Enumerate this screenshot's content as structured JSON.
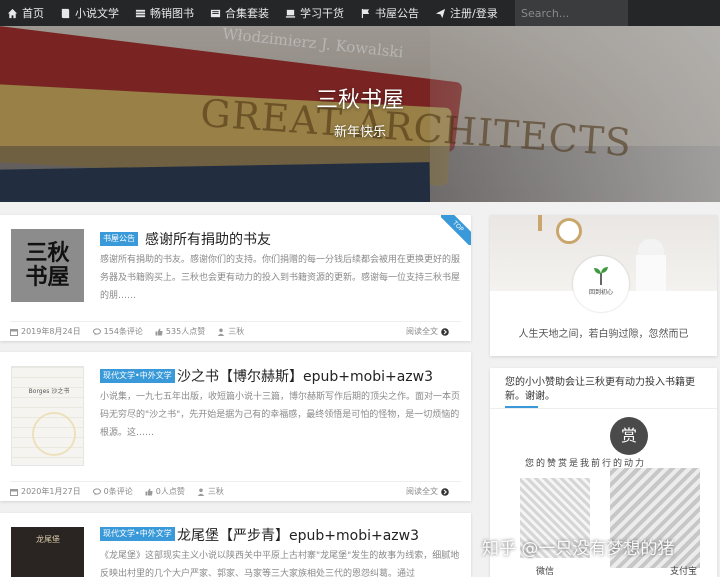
{
  "nav": {
    "items": [
      {
        "label": "首页",
        "icon": "home-icon"
      },
      {
        "label": "小说文学",
        "icon": "book-icon"
      },
      {
        "label": "畅销图书",
        "icon": "list-icon"
      },
      {
        "label": "合集套装",
        "icon": "folder-icon"
      },
      {
        "label": "学习干货",
        "icon": "laptop-icon"
      },
      {
        "label": "书屋公告",
        "icon": "flag-icon"
      },
      {
        "label": "注册/登录",
        "icon": "send-icon"
      }
    ],
    "search_placeholder": "Search..."
  },
  "hero": {
    "title": "三秋书屋",
    "subtitle": "新年快乐",
    "spine_text": "GREAT ARCHITECTS",
    "spine_text2": "Włodzimierz J. Kowalski"
  },
  "posts": [
    {
      "thumb_text": "三秋书屋",
      "category": "书屋公告",
      "title": "感谢所有捐助的书友",
      "excerpt": "感谢所有捐助的书友。感谢你们的支持。你们捐赠的每一分钱后续都会被用在更换更好的服务器及书籍购买上。三秋也会更有动力的投入到书籍资源的更新。感谢每一位支持三秋书屋的朋……",
      "date": "2019年8月24日",
      "comments": "154条评论",
      "likes": "535人点赞",
      "author": "三秋",
      "readmore": "阅读全文",
      "top": "TOP"
    },
    {
      "thumb_text": "Borges 沙之书",
      "category": "现代文学•中外文学",
      "title": "沙之书【博尔赫斯】epub+mobi+azw3",
      "excerpt": "小说集，一九七五年出版，收短篇小说十三篇，博尔赫斯写作后期的顶尖之作。面对一本页码无穷尽的\"沙之书\"，先开始是据为己有的幸福感，最终领悟是可怕的怪物，是一切烦恼的根源。这……",
      "date": "2020年1月27日",
      "comments": "0条评论",
      "likes": "0人点赞",
      "author": "三秋",
      "readmore": "阅读全文"
    },
    {
      "thumb_text": "龙尾堡",
      "category": "现代文学•中外文学",
      "title": "龙尾堡【严步青】epub+mobi+azw3",
      "excerpt": "《龙尾堡》这部现实主义小说以陕西关中平原上古村寨\"龙尾堡\"发生的故事为线索，细腻地反映出村里的几个大户严家、郭家、马家等三大家族相处三代的恩怨纠葛。通过"
    }
  ],
  "sidebar": {
    "motto": "人生天地之间，若白驹过隙，忽然而已",
    "avatar_text": "回到初心",
    "donate_heading": "您的小小赞助会让三秋更有动力投入书籍更新。谢谢。",
    "donate_badge": "赏",
    "donate_title": "您的赞赏是我前行的动力",
    "pay_wechat": "微信",
    "pay_alipay": "支付宝"
  },
  "watermark": "知乎 @一只没有梦想的猪",
  "colors": {
    "accent": "#3a9ad9",
    "nav_bg": "#242628"
  }
}
